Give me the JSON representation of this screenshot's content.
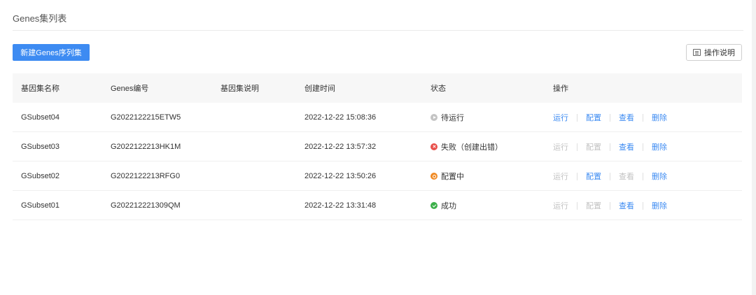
{
  "page": {
    "title": "Genes集列表",
    "new_button": "新建Genes序列集",
    "help_button": "操作说明"
  },
  "table": {
    "headers": [
      "基因集名称",
      "Genes编号",
      "基因集说明",
      "创建时间",
      "状态",
      "操作"
    ],
    "rows": [
      {
        "name": "GSubset04",
        "genes_id": "G2022122215ETW5",
        "description": "",
        "created": "2022-12-22 15:08:36",
        "status": "待运行",
        "status_icon": "pending",
        "actions": [
          {
            "label": "运行",
            "enabled": true
          },
          {
            "label": "配置",
            "enabled": true
          },
          {
            "label": "查看",
            "enabled": true
          },
          {
            "label": "删除",
            "enabled": true
          }
        ]
      },
      {
        "name": "GSubset03",
        "genes_id": "G2022122213HK1M",
        "description": "",
        "created": "2022-12-22 13:57:32",
        "status": "失败（创建出错）",
        "status_icon": "failed",
        "actions": [
          {
            "label": "运行",
            "enabled": false
          },
          {
            "label": "配置",
            "enabled": false
          },
          {
            "label": "查看",
            "enabled": true
          },
          {
            "label": "删除",
            "enabled": true
          }
        ]
      },
      {
        "name": "GSubset02",
        "genes_id": "G2022122213RFG0",
        "description": "",
        "created": "2022-12-22 13:50:26",
        "status": "配置中",
        "status_icon": "config",
        "actions": [
          {
            "label": "运行",
            "enabled": false
          },
          {
            "label": "配置",
            "enabled": true
          },
          {
            "label": "查看",
            "enabled": false
          },
          {
            "label": "删除",
            "enabled": true
          }
        ]
      },
      {
        "name": "GSubset01",
        "genes_id": "G202212221309QM",
        "description": "",
        "created": "2022-12-22 13:31:48",
        "status": "成功",
        "status_icon": "success",
        "actions": [
          {
            "label": "运行",
            "enabled": false
          },
          {
            "label": "配置",
            "enabled": false
          },
          {
            "label": "查看",
            "enabled": true
          },
          {
            "label": "删除",
            "enabled": true
          }
        ]
      }
    ]
  },
  "colors": {
    "primary": "#3d8bf2",
    "disabled": "#c2c2c2",
    "failed": "#e8504b",
    "config": "#f08a24",
    "success": "#3cb04a",
    "pending": "#c4c4c4"
  }
}
